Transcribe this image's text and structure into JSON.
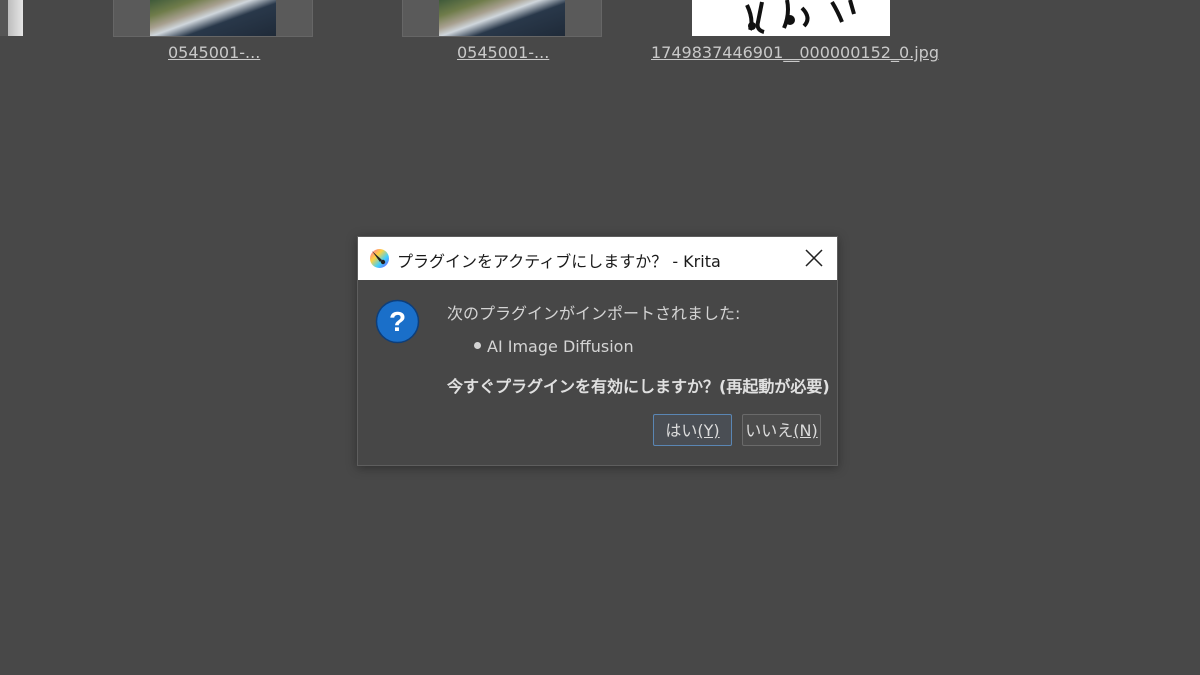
{
  "background": {
    "files": [
      {
        "label": "0545001-..."
      },
      {
        "label": "0545001-..."
      },
      {
        "label": "1749837446901__000000152_0.jpg"
      }
    ]
  },
  "dialog": {
    "title": "プラグインをアクティブにしますか？ - Krita",
    "icon": "krita-logo-icon",
    "message_intro": "次のプラグインがインポートされました:",
    "plugins": [
      "AI Image Diffusion"
    ],
    "question": "今すぐプラグインを有効にしますか？(再起動が必要)",
    "buttons": {
      "yes": {
        "label": "はい",
        "mnemonic": "(Y)"
      },
      "no": {
        "label": "いいえ",
        "mnemonic": "(N)"
      }
    },
    "accent_color": "#1a6fc9"
  }
}
